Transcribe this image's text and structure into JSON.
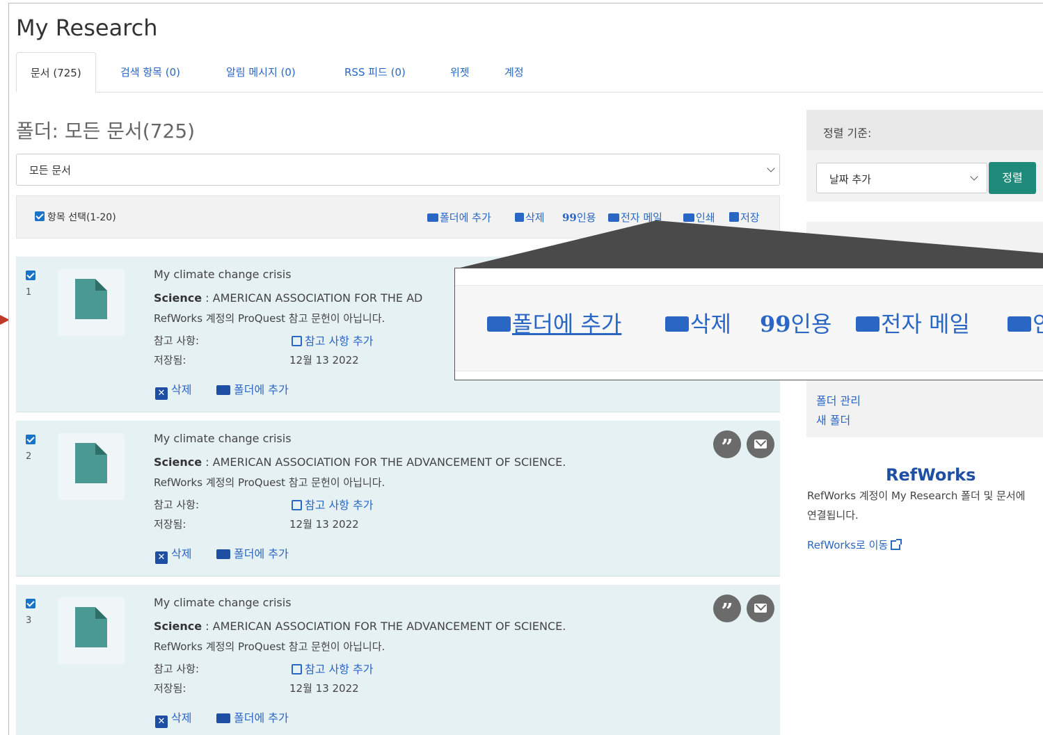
{
  "page": {
    "title": "My Research"
  },
  "tabs": [
    {
      "label": "문서 (725)",
      "active": true
    },
    {
      "label": "검색 항목 (0)"
    },
    {
      "label": "알림 메시지 (0)"
    },
    {
      "label": "RSS 피드 (0)"
    },
    {
      "label": "위젯"
    },
    {
      "label": "계정"
    }
  ],
  "folder": {
    "heading": "폴더: 모든 문서(725)",
    "filter_value": "모든 문서"
  },
  "toolbar": {
    "select_label": "항목 선택(1-20)",
    "actions": [
      {
        "label": "폴더에 추가",
        "icon": "folder-add-icon"
      },
      {
        "label": "삭제",
        "icon": "delete-icon"
      },
      {
        "label": "인용",
        "icon": "quote-icon"
      },
      {
        "label": "전자 메일",
        "icon": "email-icon"
      },
      {
        "label": "인쇄",
        "icon": "print-icon"
      },
      {
        "label": "저장",
        "icon": "save-icon"
      }
    ]
  },
  "zoom": {
    "actions": [
      {
        "label": "폴더에 추가",
        "icon": "folder-add-icon"
      },
      {
        "label": "삭제",
        "icon": "delete-icon"
      },
      {
        "label": "인용",
        "icon": "quote-icon"
      },
      {
        "label": "전자 메일",
        "icon": "email-icon"
      },
      {
        "label": "인",
        "icon": "print-icon"
      }
    ]
  },
  "documents": [
    {
      "number": "1",
      "title": "My climate change crisis",
      "publication": "Science",
      "publisher": "AMERICAN ASSOCIATION FOR THE AD",
      "note": "RefWorks 계정의 ProQuest 참고 문헌이 아닙니다.",
      "notes_label": "참고 사항:",
      "add_note": "참고 사항 추가",
      "saved_label": "저장됨:",
      "saved_date": "12월 13 2022",
      "delete": "삭제",
      "add_to_folder": "폴더에 추가"
    },
    {
      "number": "2",
      "title": "My climate change crisis",
      "publication": "Science",
      "publisher": "AMERICAN ASSOCIATION FOR THE ADVANCEMENT OF SCIENCE.",
      "note": "RefWorks 계정의 ProQuest 참고 문헌이 아닙니다.",
      "notes_label": "참고 사항:",
      "add_note": "참고 사항 추가",
      "saved_label": "저장됨:",
      "saved_date": "12월 13 2022",
      "delete": "삭제",
      "add_to_folder": "폴더에 추가"
    },
    {
      "number": "3",
      "title": "My climate change crisis",
      "publication": "Science",
      "publisher": "AMERICAN ASSOCIATION FOR THE ADVANCEMENT OF SCIENCE.",
      "note": "RefWorks 계정의 ProQuest 참고 문헌이 아닙니다.",
      "notes_label": "참고 사항:",
      "add_note": "참고 사항 추가",
      "saved_label": "저장됨:",
      "saved_date": "12월 13 2022",
      "delete": "삭제",
      "add_to_folder": "폴더에 추가"
    }
  ],
  "sidebar": {
    "sort_label": "정렬 기준:",
    "sort_value": "날짜 추가",
    "sort_button": "정렬",
    "manage_folders": "폴더 관리",
    "new_folder": "새 폴더",
    "refworks_title": "RefWorks",
    "refworks_desc": "RefWorks 계정이 My Research 폴더 및 문서에 연결됩니다.",
    "refworks_link": "RefWorks로 이동"
  },
  "colors": {
    "link": "#2a66c4",
    "card_bg": "#e6f1f4",
    "sort_button": "#1d8a7a",
    "doc_icon": "#4a9a93",
    "arrow": "#c0392b"
  }
}
